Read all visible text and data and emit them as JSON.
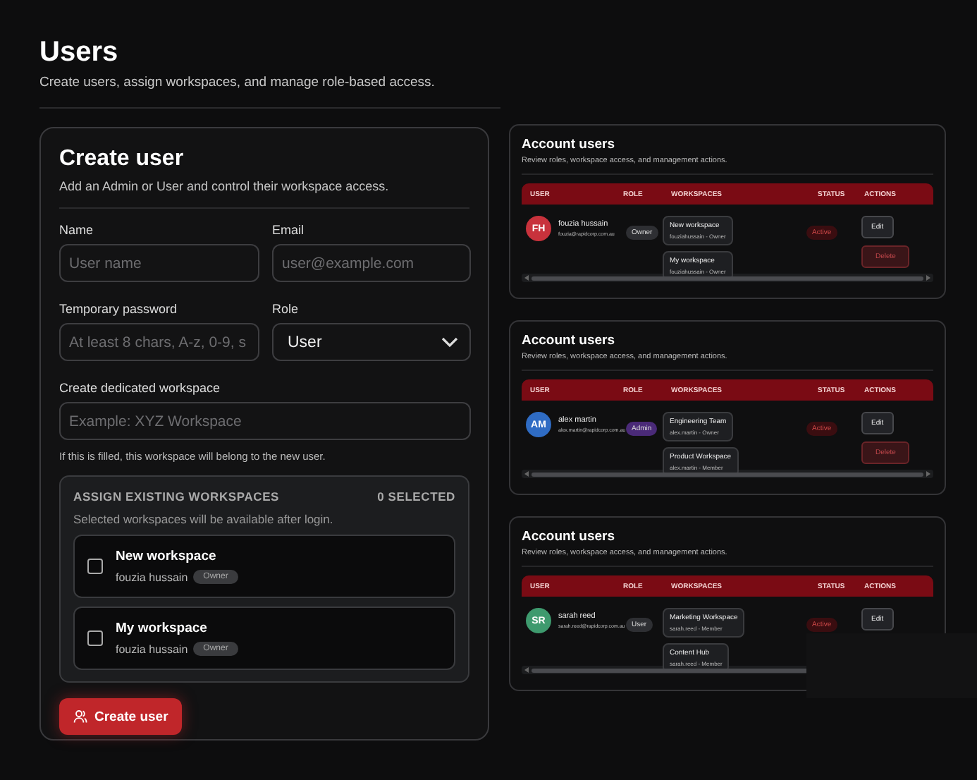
{
  "page": {
    "title": "Users",
    "subtitle": "Create users, assign workspaces, and manage role-based access."
  },
  "create_user": {
    "title": "Create user",
    "subtitle": "Add an Admin or User and control their workspace access.",
    "fields": [
      {
        "kind": "text",
        "label": "Name",
        "placeholder": "User name"
      },
      {
        "kind": "text",
        "label": "Email",
        "placeholder": "user@example.com"
      },
      {
        "kind": "text",
        "label": "Temporary password",
        "placeholder": "At least 8 chars, A-z, 0-9, s"
      },
      {
        "kind": "select",
        "label": "Role",
        "value": "User"
      },
      {
        "kind": "wide",
        "label": "Create dedicated workspace",
        "placeholder": "Example: XYZ Workspace",
        "hint": "If this is filled, this workspace will belong to the new user."
      }
    ],
    "assign": {
      "title": "ASSIGN EXISTING WORKSPACES",
      "count": "0 SELECTED",
      "subtitle": "Selected workspaces will be available after login.",
      "workspaces": [
        {
          "name": "New workspace",
          "owner": "fouzia hussain",
          "role": "Owner",
          "checked": false
        },
        {
          "name": "My workspace",
          "owner": "fouzia hussain",
          "role": "Owner",
          "checked": false
        }
      ]
    },
    "submit": "Create user"
  },
  "account_panels": [
    {
      "title": "Account users",
      "subtitle": "Review roles, workspace access, and management actions.",
      "columns": [
        "USER",
        "ROLE",
        "WORKSPACES",
        "STATUS",
        "ACTIONS"
      ],
      "user": {
        "initials": "FH",
        "color": "#c8323c",
        "name": "fouzia hussain",
        "email": "fouzia@rapidcorp.com.au",
        "role": {
          "label": "Owner",
          "color": "#2e2f33"
        },
        "workspaces": [
          {
            "name": "New workspace",
            "detail": "fouziahussain - Owner"
          },
          {
            "name": "My workspace",
            "detail": "fouziahussain - Owner"
          }
        ],
        "status": "Active",
        "actions": [
          {
            "kind": "edit",
            "label": "Edit"
          },
          {
            "kind": "delete",
            "label": "Delete"
          }
        ]
      }
    },
    {
      "title": "Account users",
      "subtitle": "Review roles, workspace access, and management actions.",
      "columns": [
        "USER",
        "ROLE",
        "WORKSPACES",
        "STATUS",
        "ACTIONS"
      ],
      "user": {
        "initials": "AM",
        "color": "#2f6cc4",
        "name": "alex martin",
        "email": "alex.martin@rapidcorp.com.au",
        "role": {
          "label": "Admin",
          "color": "#4a2a78"
        },
        "workspaces": [
          {
            "name": "Engineering Team",
            "detail": "alex.martin - Owner"
          },
          {
            "name": "Product Workspace",
            "detail": "alex.martin - Member"
          }
        ],
        "status": "Active",
        "actions": [
          {
            "kind": "edit",
            "label": "Edit"
          },
          {
            "kind": "delete",
            "label": "Delete"
          }
        ]
      }
    },
    {
      "title": "Account users",
      "subtitle": "Review roles, workspace access, and management actions.",
      "columns": [
        "USER",
        "ROLE",
        "WORKSPACES",
        "STATUS",
        "ACTIONS"
      ],
      "covered": true,
      "user": {
        "initials": "SR",
        "color": "#3e9a6e",
        "name": "sarah reed",
        "email": "sarah.reed@rapidcorp.com.au",
        "role": {
          "label": "User",
          "color": "#2e2f33"
        },
        "workspaces": [
          {
            "name": "Marketing Workspace",
            "detail": "sarah.reed - Member"
          },
          {
            "name": "Content Hub",
            "detail": "sarah.reed - Member"
          }
        ],
        "status": "Active",
        "actions": [
          {
            "kind": "edit",
            "label": "Edit"
          }
        ]
      }
    }
  ]
}
